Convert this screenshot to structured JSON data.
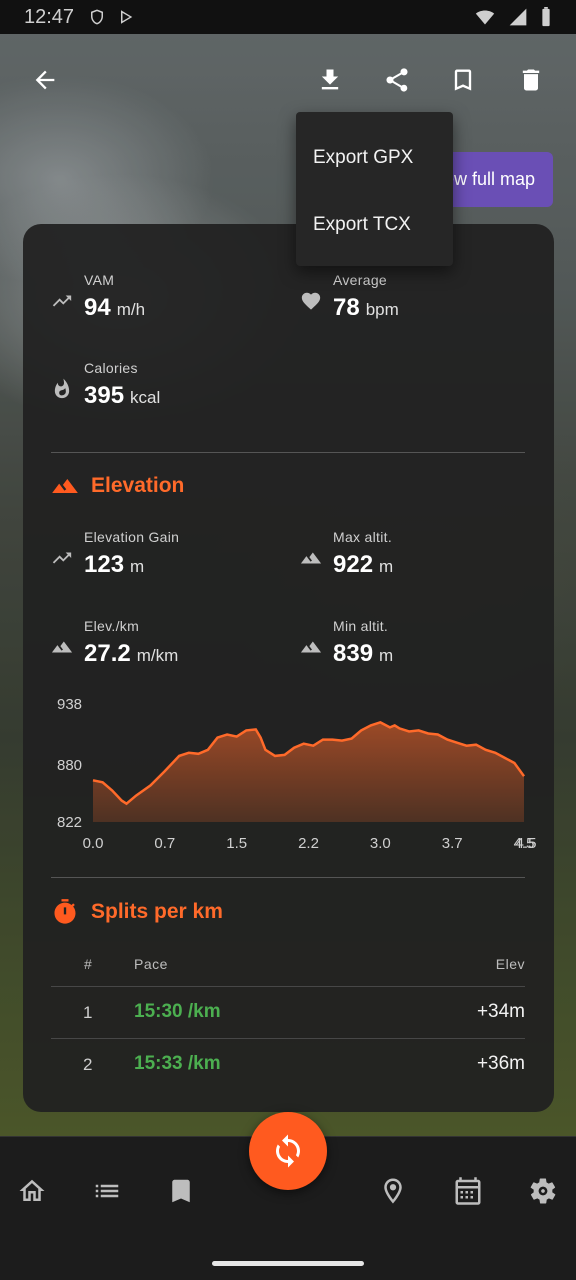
{
  "status_bar": {
    "time": "12:47"
  },
  "toolbar": {
    "back_icon": "arrow-back-icon",
    "download_icon": "download-icon",
    "share_icon": "share-icon",
    "bookmark_icon": "bookmark-icon",
    "delete_icon": "delete-icon"
  },
  "view_map": {
    "label": "ew full map"
  },
  "export_menu": {
    "items": [
      {
        "label": "Export GPX"
      },
      {
        "label": "Export TCX"
      }
    ]
  },
  "summary": {
    "vam": {
      "label": "VAM",
      "value": "94",
      "unit": "m/h"
    },
    "average": {
      "label": "Average",
      "value": "78",
      "unit": "bpm"
    },
    "calories": {
      "label": "Calories",
      "value": "395",
      "unit": "kcal"
    }
  },
  "elevation": {
    "title": "Elevation",
    "gain": {
      "label": "Elevation Gain",
      "value": "123",
      "unit": "m"
    },
    "max": {
      "label": "Max altit.",
      "value": "922",
      "unit": "m"
    },
    "per_km": {
      "label": "Elev./km",
      "value": "27.2",
      "unit": "m/km"
    },
    "min": {
      "label": "Min altit.",
      "value": "839",
      "unit": "m"
    }
  },
  "chart_data": {
    "type": "area",
    "title": "",
    "xlabel": "",
    "ylabel": "",
    "y_ticks": [
      "938",
      "880",
      "822"
    ],
    "x_ticks": [
      "0.0",
      "0.7",
      "1.5",
      "2.2",
      "3.0",
      "3.7",
      "4.5",
      "4.5"
    ],
    "ylim": [
      822,
      938
    ],
    "xlim": [
      0,
      4.5
    ],
    "color": "#ff6a2a",
    "x": [
      0.0,
      0.1,
      0.2,
      0.3,
      0.35,
      0.45,
      0.6,
      0.75,
      0.9,
      1.0,
      1.1,
      1.2,
      1.3,
      1.4,
      1.5,
      1.6,
      1.7,
      1.75,
      1.8,
      1.9,
      2.0,
      2.1,
      2.2,
      2.3,
      2.4,
      2.5,
      2.6,
      2.7,
      2.8,
      2.9,
      3.0,
      3.1,
      3.15,
      3.2,
      3.3,
      3.4,
      3.5,
      3.6,
      3.7,
      3.8,
      3.9,
      4.0,
      4.1,
      4.2,
      4.3,
      4.4,
      4.5
    ],
    "y": [
      863,
      861,
      853,
      843,
      840,
      848,
      858,
      872,
      887,
      890,
      889,
      893,
      905,
      908,
      906,
      912,
      913,
      905,
      893,
      887,
      888,
      895,
      899,
      897,
      903,
      903,
      902,
      904,
      912,
      917,
      920,
      915,
      917,
      914,
      911,
      912,
      909,
      908,
      903,
      900,
      897,
      898,
      893,
      890,
      885,
      880,
      867
    ],
    "grid": false,
    "legend": "none"
  },
  "splits": {
    "title": "Splits per km",
    "headers": {
      "index": "#",
      "pace": "Pace",
      "elev": "Elev"
    },
    "rows": [
      {
        "index": "1",
        "pace": "15:30 /km",
        "elev": "+34m"
      },
      {
        "index": "2",
        "pace": "15:33 /km",
        "elev": "+36m"
      }
    ]
  },
  "bottom_nav": {
    "items": [
      "home-icon",
      "list-icon",
      "bookmark-icon",
      "location-icon",
      "calendar-icon",
      "settings-icon"
    ],
    "fab_icon": "sync-icon"
  },
  "colors": {
    "accent": "#ff5a1f",
    "pace_green": "#4caf50",
    "map_button": "#6a4fb5"
  }
}
